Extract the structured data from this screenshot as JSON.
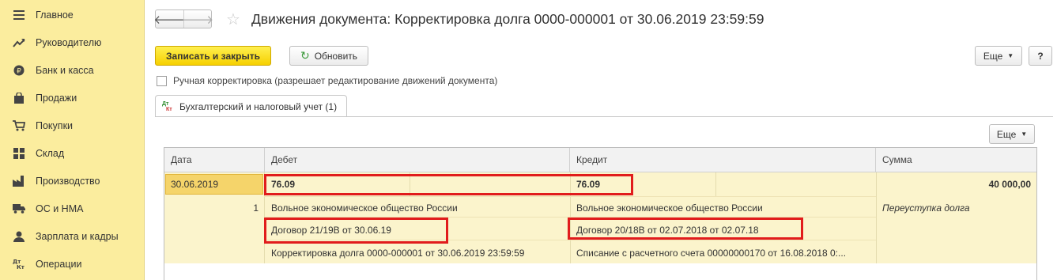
{
  "sidebar": {
    "items": [
      {
        "icon": "menu-icon",
        "label": "Главное"
      },
      {
        "icon": "trend-icon",
        "label": "Руководителю"
      },
      {
        "icon": "coin-icon",
        "label": "Банк и касса"
      },
      {
        "icon": "bag-icon",
        "label": "Продажи"
      },
      {
        "icon": "cart-icon",
        "label": "Покупки"
      },
      {
        "icon": "warehouse-icon",
        "label": "Склад"
      },
      {
        "icon": "factory-icon",
        "label": "Производство"
      },
      {
        "icon": "truck-icon",
        "label": "ОС и НМА"
      },
      {
        "icon": "person-icon",
        "label": "Зарплата и кадры"
      },
      {
        "icon": "dt-kt-icon",
        "label": "Операции"
      }
    ]
  },
  "header": {
    "title": "Движения документа: Корректировка долга 0000-000001 от 30.06.2019 23:59:59"
  },
  "toolbar": {
    "save_close": "Записать и закрыть",
    "refresh": "Обновить",
    "more": "Еще",
    "help": "?"
  },
  "manual_correction": {
    "label": "Ручная корректировка (разрешает редактирование движений документа)",
    "checked": false
  },
  "tab": {
    "icon_dt": "Дт",
    "icon_kt": "Кт",
    "label": "Бухгалтерский и налоговый учет (1)"
  },
  "table_toolbar": {
    "more": "Еще"
  },
  "table": {
    "columns": [
      "Дата",
      "Дебет",
      "Кредит",
      "Сумма"
    ],
    "row": {
      "date": "30.06.2019",
      "line_no": "1",
      "debit_account": "76.09",
      "credit_account": "76.09",
      "amount": "40 000,00",
      "content": "Переуступка долга",
      "debit_subconto1": "Вольное экономическое общество России",
      "debit_subconto2": "Договор 21/19В от 30.06.19",
      "debit_subconto3": "Корректировка долга 0000-000001 от 30.06.2019 23:59:59",
      "credit_subconto1": "Вольное экономическое общество России",
      "credit_subconto2": "Договор 20/18В от 02.07.2018 от 02.07.18",
      "credit_subconto3": "Списание с расчетного счета 00000000170 от 16.08.2018 0:..."
    }
  },
  "colors": {
    "sidebar_bg": "#fbed9e",
    "primary_button": "#f6d000",
    "row_bg": "#fbf4cc",
    "highlight": "#e11c1c"
  }
}
